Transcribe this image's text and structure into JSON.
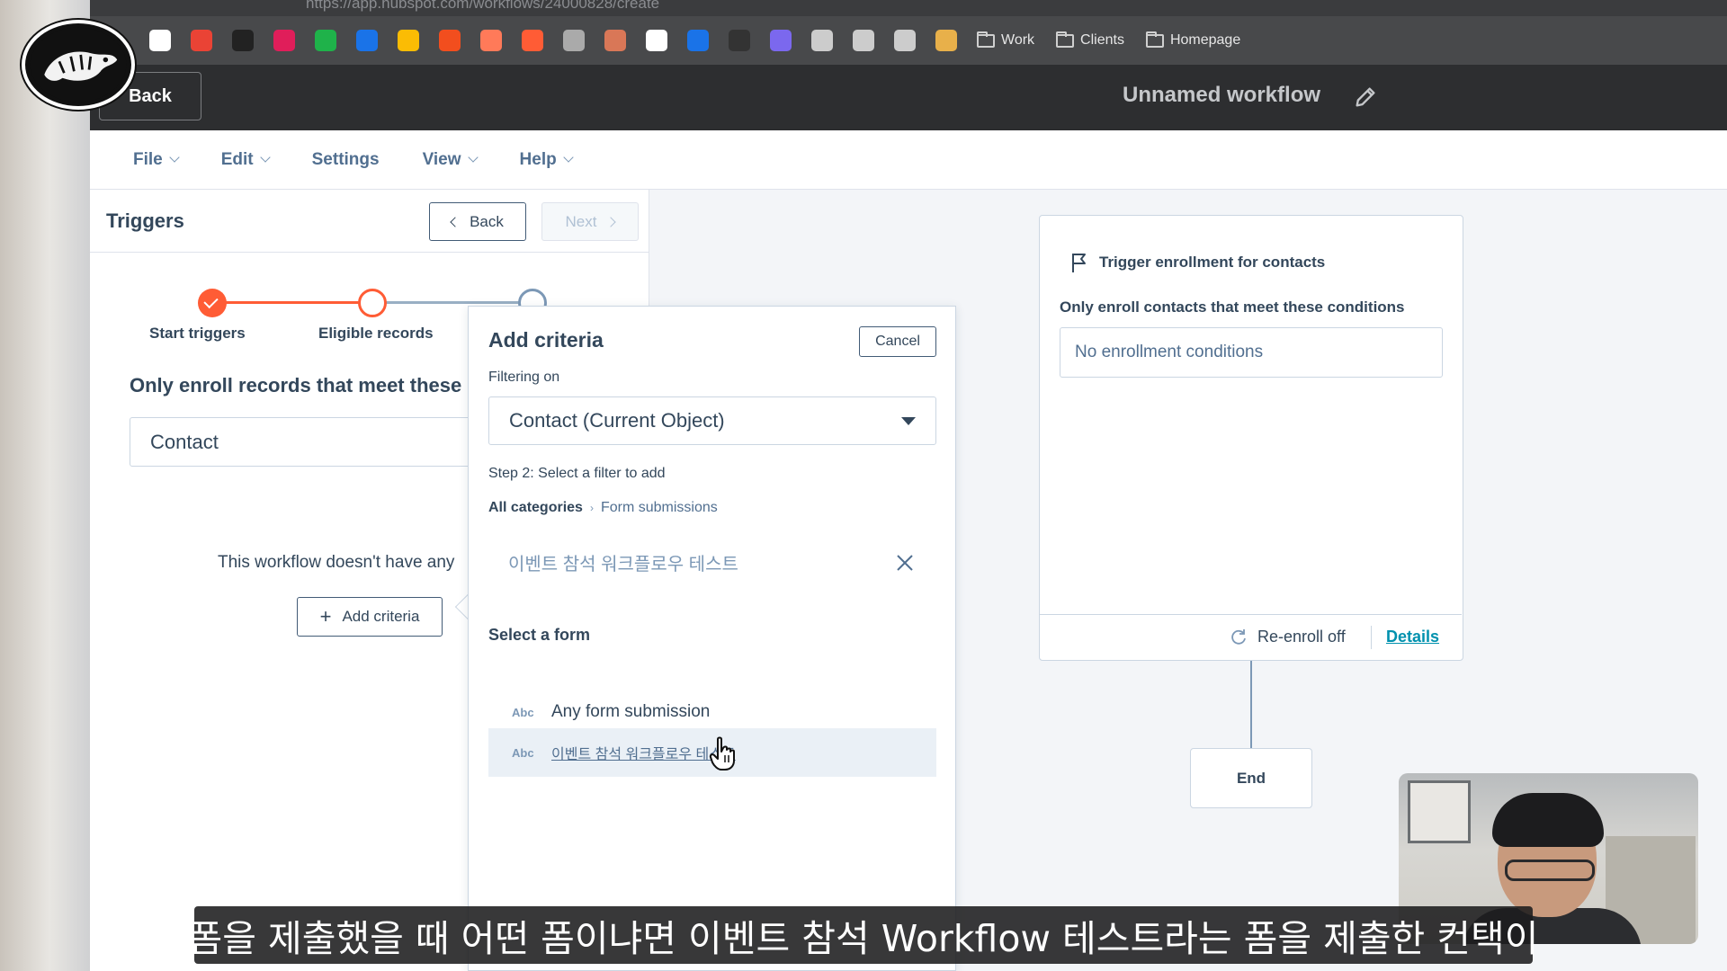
{
  "browser": {
    "url": "https://app.hubspot.com/workflows/24000828/create",
    "bookmarks": [
      {
        "icon": "google-icon",
        "color": "#ffffff"
      },
      {
        "icon": "gmail-icon",
        "color": "#ea4335"
      },
      {
        "icon": "app-icon",
        "color": "#222222"
      },
      {
        "icon": "slack-icon",
        "color": "#e01e5a"
      },
      {
        "icon": "notion-icon",
        "color": "#1fb24a"
      },
      {
        "icon": "calendar-icon",
        "color": "#1a73e8"
      },
      {
        "icon": "drive-icon",
        "color": "#fbbc04"
      },
      {
        "icon": "figma-icon",
        "color": "#f24e1e"
      },
      {
        "icon": "hubspot-icon",
        "color": "#ff7a59"
      },
      {
        "icon": "hubspot-square-icon",
        "color": "#ff5c35"
      },
      {
        "icon": "openai-icon",
        "color": "#aaaaaa"
      },
      {
        "icon": "claude-icon",
        "color": "#d97757"
      },
      {
        "icon": "info-icon",
        "color": "#ffffff"
      },
      {
        "icon": "docs-icon",
        "color": "#1a73e8"
      },
      {
        "icon": "nine-icon",
        "color": "#333333"
      },
      {
        "icon": "grid-icon",
        "color": "#7b68ee"
      },
      {
        "icon": "globe-icon",
        "color": "#cccccc"
      },
      {
        "icon": "pen-icon",
        "color": "#cccccc"
      },
      {
        "icon": "globe-icon-2",
        "color": "#cccccc"
      },
      {
        "icon": "palette-icon",
        "color": "#e8b04a"
      }
    ],
    "folders": [
      "Work",
      "Clients",
      "Homepage"
    ]
  },
  "header": {
    "back_label": "Back",
    "workflow_title": "Unnamed workflow"
  },
  "menu": {
    "file": "File",
    "edit": "Edit",
    "settings": "Settings",
    "view": "View",
    "help": "Help"
  },
  "triggers_panel": {
    "title": "Triggers",
    "back": "Back",
    "next": "Next",
    "steps": [
      "Start triggers",
      "Eligible records"
    ],
    "enroll_heading": "Only enroll records that meet these",
    "object": "Contact",
    "empty_text": "This workflow doesn't have any",
    "add_criteria": "Add criteria"
  },
  "add_criteria_popover": {
    "title": "Add criteria",
    "cancel": "Cancel",
    "filtering_label": "Filtering on",
    "filtering_value": "Contact (Current Object)",
    "step_label": "Step 2: Select a filter to add",
    "crumb_all": "All categories",
    "crumb_current": "Form submissions",
    "search_value": "이벤트 참석 워크플로우 테스트",
    "select_form_heading": "Select a form",
    "options": [
      {
        "type": "Abc",
        "label": "Any form submission"
      },
      {
        "type": "Abc",
        "label": "이벤트 참석 워크플로우 테스트"
      }
    ]
  },
  "workflow_canvas": {
    "trigger_title": "Trigger enrollment for contacts",
    "only_enroll": "Only enroll contacts that meet these conditions",
    "conditions": "No enrollment conditions",
    "reenroll": "Re-enroll off",
    "details": "Details",
    "end": "End"
  },
  "subtitle": "폼을 제출했을 때 어떤 폼이냐면 이벤트 참석 Workflow 테스트라는 폼을 제출한 컨택이"
}
